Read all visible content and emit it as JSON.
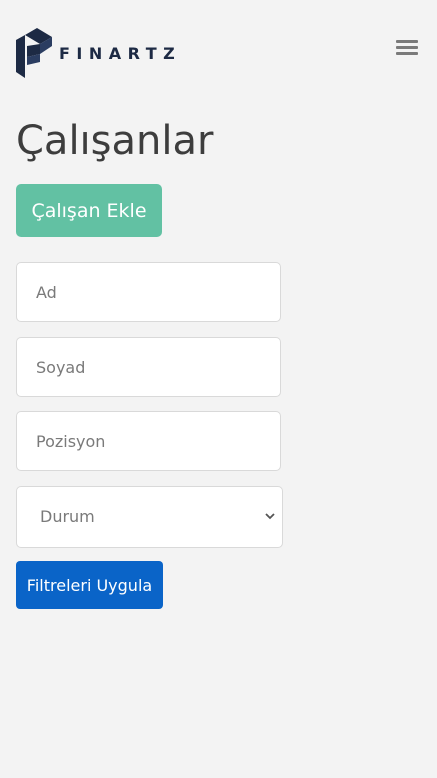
{
  "brand": {
    "name": "FINARTZ",
    "logo_icon": "finartz-f-logo",
    "color": "#1d2a44"
  },
  "header": {
    "menu_icon": "hamburger-menu-icon"
  },
  "page": {
    "title": "Çalışanlar"
  },
  "actions": {
    "add_employee_label": "Çalışan Ekle",
    "add_employee_color": "#62c1a3"
  },
  "filters": {
    "first_name_placeholder": "Ad",
    "last_name_placeholder": "Soyad",
    "position_placeholder": "Pozisyon",
    "status_selected": "Durum",
    "status_icon": "chevron-down-icon",
    "apply_label": "Filtreleri Uygula",
    "apply_color": "#0a64c8"
  }
}
